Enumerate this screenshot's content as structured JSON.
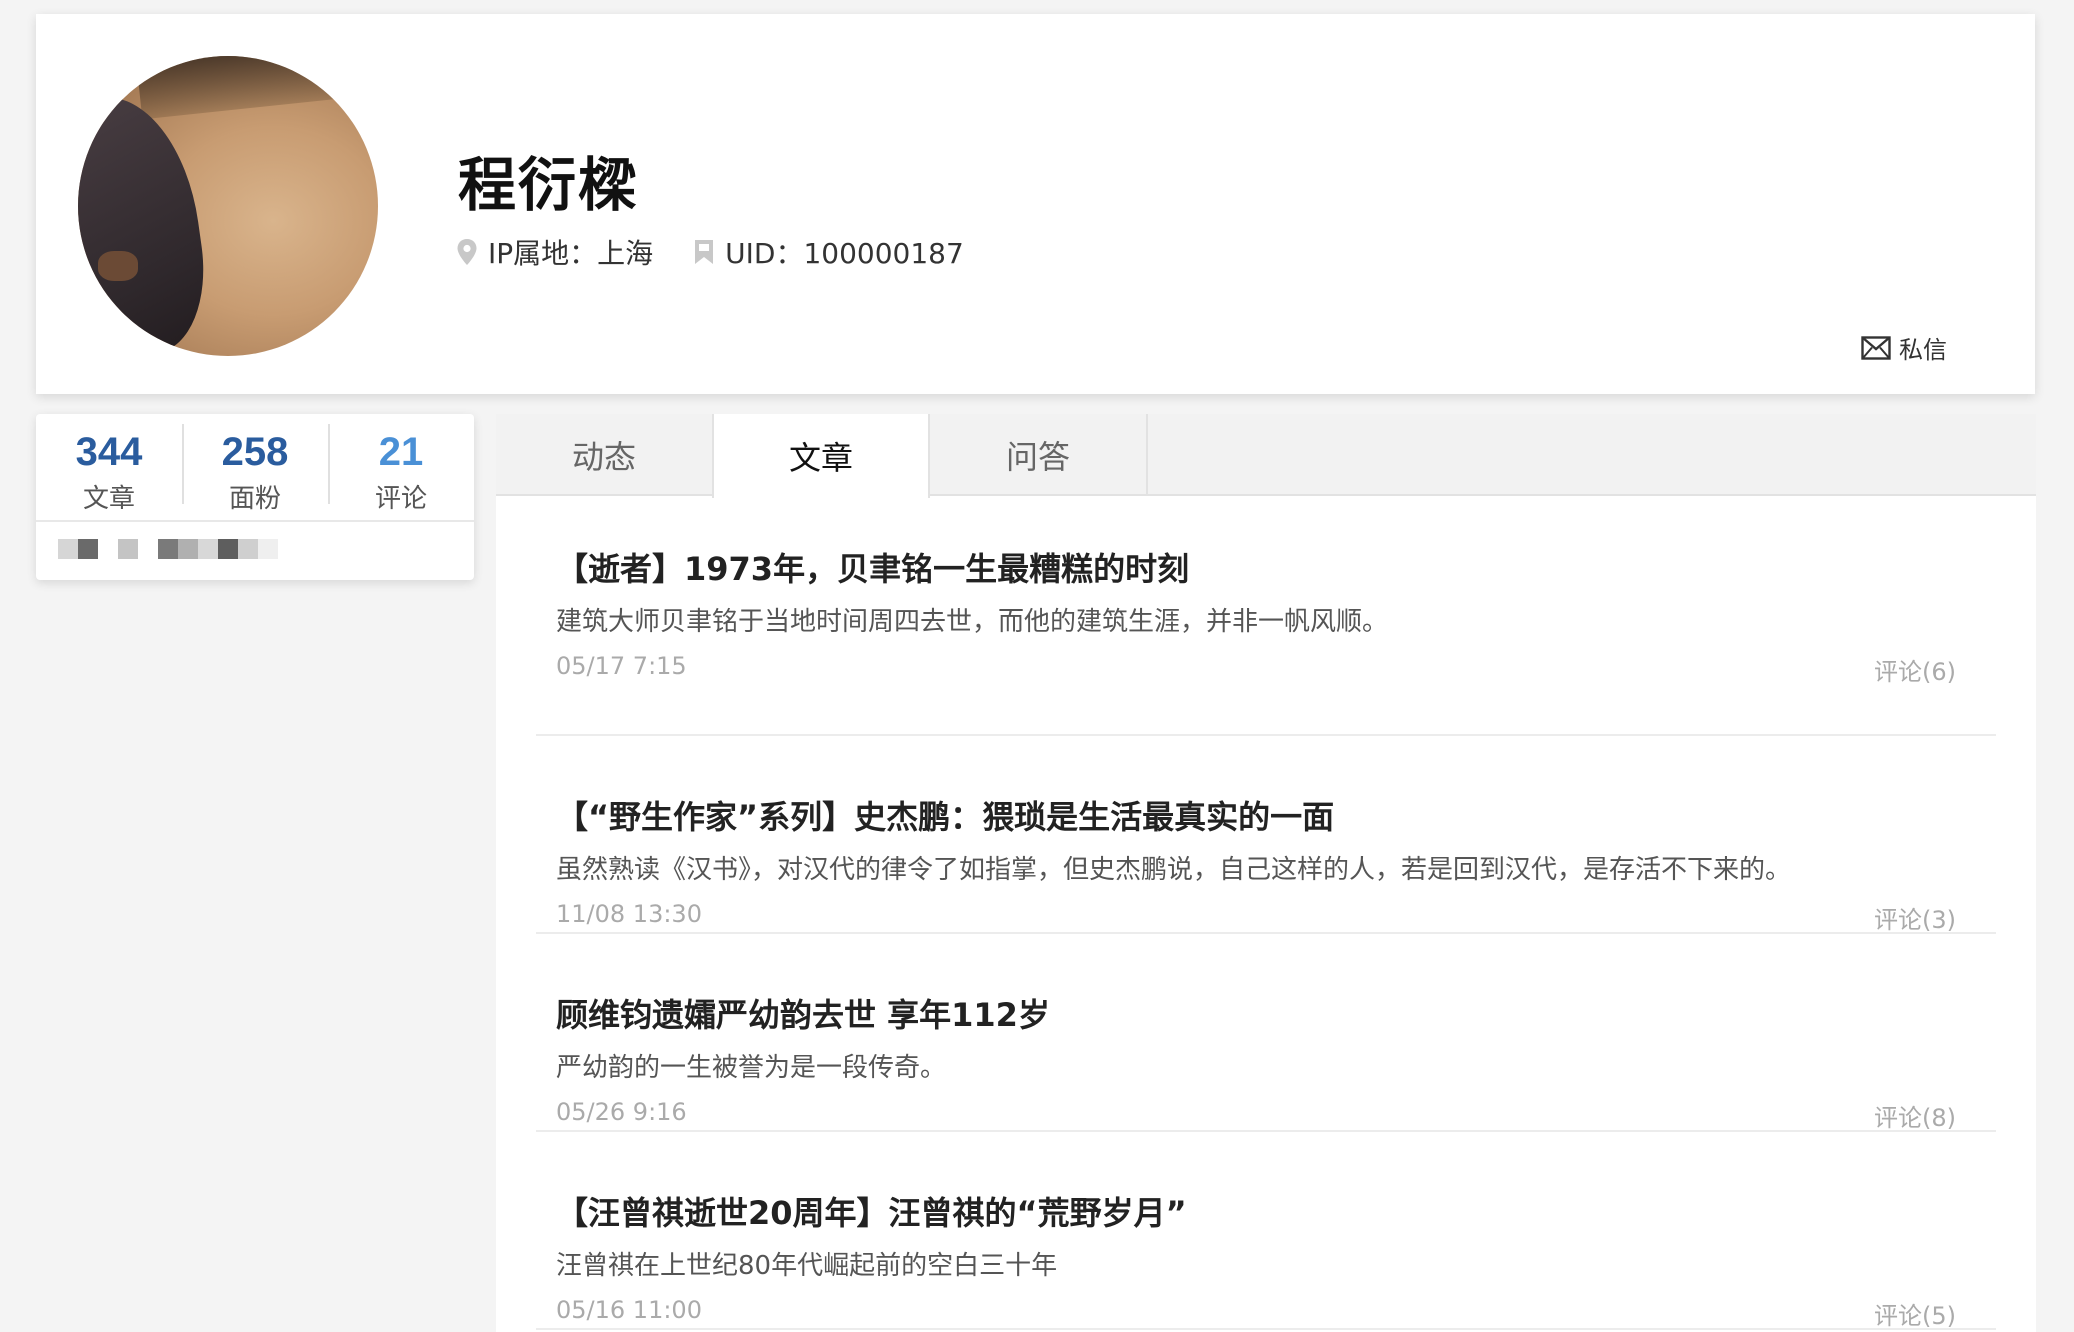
{
  "profile": {
    "name": "程衍樑",
    "ip_label": "IP属地：上海",
    "uid_label": "UID：100000187",
    "dm_label": "私信"
  },
  "stats": [
    {
      "value": "344",
      "label": "文章"
    },
    {
      "value": "258",
      "label": "面粉"
    },
    {
      "value": "21",
      "label": "评论"
    }
  ],
  "tabs": [
    {
      "label": "动态",
      "active": false
    },
    {
      "label": "文章",
      "active": true
    },
    {
      "label": "问答",
      "active": false
    }
  ],
  "articles": [
    {
      "title": "【逝者】1973年，贝聿铭一生最糟糕的时刻",
      "summary": "建筑大师贝聿铭于当地时间周四去世，而他的建筑生涯，并非一帆风顺。",
      "date": "05/17 7:15",
      "comments": "评论(6)"
    },
    {
      "title": "【“野生作家”系列】史杰鹏：猥琐是生活最真实的一面",
      "summary": "虽然熟读《汉书》，对汉代的律令了如指掌，但史杰鹏说，自己这样的人，若是回到汉代，是存活不下来的。",
      "date": "11/08 13:30",
      "comments": "评论(3)"
    },
    {
      "title": "顾维钧遗孀严幼韵去世 享年112岁",
      "summary": "严幼韵的一生被誉为是一段传奇。",
      "date": "05/26 9:16",
      "comments": "评论(8)"
    },
    {
      "title": "【汪曾祺逝世20周年】汪曾祺的“荒野岁月”",
      "summary": "汪曾祺在上世纪80年代崛起前的空白三十年",
      "date": "05/16 11:00",
      "comments": "评论(5)"
    }
  ],
  "colors": {
    "stat_primary": "#2a5c9e",
    "stat_secondary": "#4a90d6",
    "background": "#f4f4f4"
  }
}
